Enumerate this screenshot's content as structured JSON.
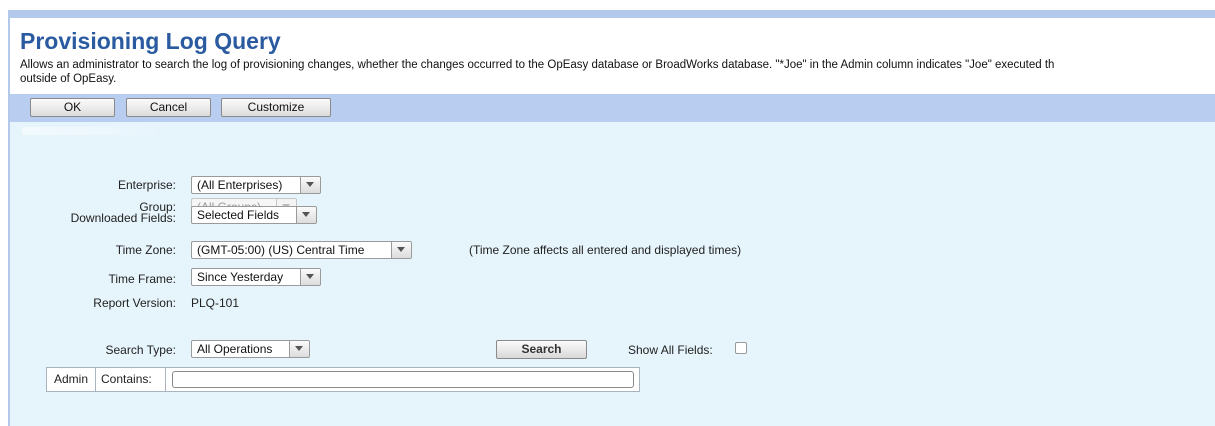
{
  "page": {
    "title": "Provisioning Log Query",
    "description_line1": "Allows an administrator to search the log of provisioning changes, whether the changes occurred to the OpEasy database or BroadWorks database. \"*Joe\" in the Admin column indicates \"Joe\" executed th",
    "description_line2": "outside of OpEasy."
  },
  "toolbar": {
    "ok_label": "OK",
    "cancel_label": "Cancel",
    "customize_label": "Customize"
  },
  "form": {
    "enterprise": {
      "label": "Enterprise:",
      "value": "(All Enterprises)"
    },
    "group": {
      "label": "Group:",
      "value": "(All Groups)"
    },
    "downloaded_fields": {
      "label": "Downloaded Fields:",
      "value": "Selected Fields"
    },
    "time_zone": {
      "label": "Time Zone:",
      "value": "(GMT-05:00) (US) Central Time",
      "note": "(Time Zone affects all entered and displayed times)"
    },
    "time_frame": {
      "label": "Time Frame:",
      "value": "Since Yesterday"
    },
    "report_version": {
      "label": "Report Version:",
      "value": "PLQ-101"
    },
    "search_type": {
      "label": "Search Type:",
      "value": "All Operations"
    },
    "search_button": "Search",
    "show_all_fields": {
      "label": "Show All Fields:",
      "checked": false
    }
  },
  "criteria": {
    "field": "Admin",
    "operator": "Contains:",
    "value": ""
  },
  "colors": {
    "title": "#2a5aa0",
    "toolbar_bg": "#b8cdef",
    "panel_bg": "#e6f4fc"
  }
}
